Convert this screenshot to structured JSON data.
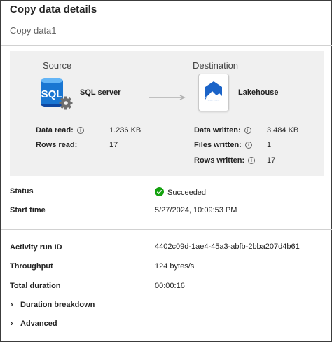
{
  "header": {
    "title": "Copy data details",
    "subtitle": "Copy data1"
  },
  "source": {
    "section_label": "Source",
    "name": "SQL server",
    "icon_text": "SQL",
    "icon": "sql-server-icon",
    "stats": [
      {
        "label": "Data read:",
        "value": "1.236 KB"
      },
      {
        "label": "Rows read:",
        "value": "17"
      }
    ]
  },
  "destination": {
    "section_label": "Destination",
    "name": "Lakehouse",
    "icon": "lakehouse-icon",
    "stats": [
      {
        "label": "Data written:",
        "value": "3.484 KB"
      },
      {
        "label": "Files written:",
        "value": "1"
      },
      {
        "label": "Rows written:",
        "value": "17"
      }
    ]
  },
  "details": {
    "status": {
      "label": "Status",
      "value": "Succeeded",
      "color": "#13a10e"
    },
    "start_time": {
      "label": "Start time",
      "value": "5/27/2024, 10:09:53 PM"
    },
    "activity_run_id": {
      "label": "Activity run ID",
      "value": "4402c09d-1ae4-45a3-abfb-2bba207d4b61"
    },
    "throughput": {
      "label": "Throughput",
      "value": "124 bytes/s"
    },
    "total_duration": {
      "label": "Total duration",
      "value": "00:00:16"
    }
  },
  "expanders": [
    {
      "label": "Duration breakdown",
      "icon": "chevron-right-icon"
    },
    {
      "label": "Advanced",
      "icon": "chevron-right-icon"
    }
  ],
  "colors": {
    "panel_bg": "#f0f0f0",
    "sql_blue": "#1976d2",
    "lakehouse_blue": "#1b64c8",
    "success_green": "#13a10e"
  }
}
